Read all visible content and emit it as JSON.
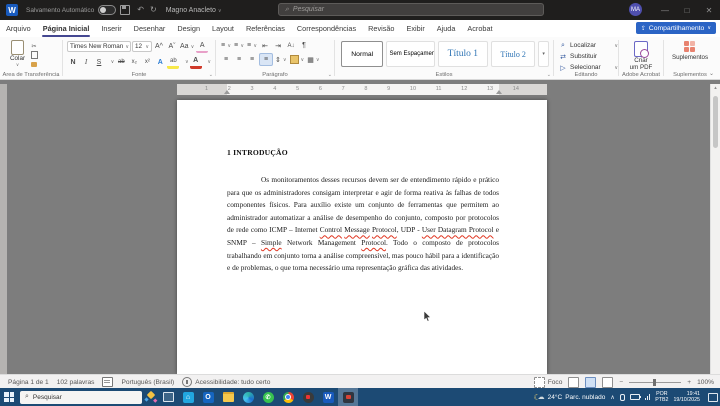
{
  "colors": {
    "accent_tab_underline": "#444791",
    "share_button_blue": "#2b64c5",
    "heading_style_blue": "#2e74b5",
    "spellcheck_red": "#e0341f",
    "taskbar_blue": "#1c4a74",
    "avatar_purple": "#4f4fae"
  },
  "titlebar": {
    "autosave_label": "Salvamento Automático",
    "doc_title": "Magno Anacleto",
    "doc_title_caret": "∨",
    "search_placeholder": "Pesquisar",
    "avatar_initials": "MA",
    "minimize": "—",
    "maximize": "□",
    "close": "✕",
    "word_logo_letter": "W",
    "undo_icon": "↶",
    "redo_icon": "↻",
    "search_icon": "⌕"
  },
  "tabs": {
    "items": [
      {
        "label": "Arquivo"
      },
      {
        "label": "Página Inicial",
        "active": true
      },
      {
        "label": "Inserir"
      },
      {
        "label": "Desenhar"
      },
      {
        "label": "Design"
      },
      {
        "label": "Layout"
      },
      {
        "label": "Referências"
      },
      {
        "label": "Correspondências"
      },
      {
        "label": "Revisão"
      },
      {
        "label": "Exibir"
      },
      {
        "label": "Ajuda"
      },
      {
        "label": "Acrobat"
      }
    ],
    "share_label": "Compartilhamento",
    "share_caret": "∨"
  },
  "ribbon": {
    "clipboard": {
      "paste": "Colar",
      "caret": "∨",
      "cut_icon": "✂",
      "group": "Área de Transferência"
    },
    "font": {
      "family": "Times New Roman",
      "size": "12",
      "grow": "A^",
      "shrink": "Aˇ",
      "case": "Aa",
      "clear": "A",
      "bold": "N",
      "italic": "I",
      "underline": "S",
      "strike": "ab",
      "subscript": "x₂",
      "superscript": "x²",
      "effects": "A",
      "highlight": "ab",
      "fontcolor": "A",
      "group": "Fonte"
    },
    "paragraph": {
      "bullets": "≡",
      "numbering": "≡",
      "multilevel": "≡",
      "outdent": "⇤",
      "indent": "⇥",
      "sort": "A↓",
      "pilcrow": "¶",
      "align_left": "≡",
      "align_center": "≡",
      "align_right": "≡",
      "justify": "≡",
      "spacing": "⇕",
      "borders": "▦",
      "group": "Parágrafo"
    },
    "styles": {
      "items": [
        "Normal",
        "Sem Espaçamento",
        "Título 1",
        "Título 2"
      ],
      "more": "▾",
      "group": "Estilos"
    },
    "editing": {
      "find": "Localizar",
      "find_icon": "⌕",
      "replace": "Substituir",
      "replace_icon": "⇄",
      "select": "Selecionar",
      "select_icon": "▷",
      "caret": "∨",
      "group": "Editando"
    },
    "acrobat": {
      "button_line1": "Criar",
      "button_line2": "um PDF",
      "group": "Adobe Acrobat"
    },
    "addins": {
      "button": "Suplementos",
      "group": "Suplementos"
    },
    "collapse_icon": "⌄"
  },
  "ruler": {
    "numbers": [
      "1",
      "2",
      "3",
      "4",
      "5",
      "6",
      "7",
      "8",
      "9",
      "10",
      "11",
      "12",
      "13",
      "14"
    ],
    "scroll_up": "▴"
  },
  "document": {
    "heading": "1 INTRODUÇÃO",
    "paragraph": [
      {
        "text": "Os monitoramentos desses recursos devem ser de entendimento rápido e prático para que os administradores consigam interpretar e agir de forma reativa às falhas de todos componentes físicos. Para auxílio existe um conjunto de ferramentas que permitem ao administrador automatizar a análise de desempenho do conjunto, composto por protocolos de rede como ICMP – Internet "
      },
      {
        "text": "Control",
        "wavy": true
      },
      {
        "text": " "
      },
      {
        "text": "Message",
        "wavy": true
      },
      {
        "text": " "
      },
      {
        "text": "Protocol",
        "wavy": true
      },
      {
        "text": ", UDP - "
      },
      {
        "text": "User Datagram Protocol",
        "wavy": true
      },
      {
        "text": " e SNMP – "
      },
      {
        "text": "Simple",
        "wavy": true
      },
      {
        "text": " Network Management "
      },
      {
        "text": "Protocol",
        "wavy": true
      },
      {
        "text": ". Todo o composto de protocolos trabalhando em conjunto torna a análise compreensível, mas pouco hábil para a identificação e de problemas, o que torna necessário uma representação gráfica das atividades."
      }
    ]
  },
  "statusbar": {
    "page": "Página 1 de 1",
    "words": "102 palavras",
    "language": "Português (Brasil)",
    "accessibility": "Acessibilidade: tudo certo",
    "focus": "Foco",
    "zoom_minus": "−",
    "zoom_plus": "+",
    "zoom_level": "100%"
  },
  "taskbar": {
    "search_placeholder": "Pesquisar",
    "search_icon": "⌕",
    "weather_moon": "☾",
    "weather_cloud": "☁",
    "weather_temp": "24°C",
    "weather_desc": "Parc. nublado",
    "tray_chevron": "∧",
    "lang_top": "POR",
    "lang_bottom": "PTB2",
    "time": "19:41",
    "date": "19/10/2025",
    "word_letter": "W",
    "outlook_letter": "O",
    "whatsapp_letter": "✆"
  }
}
